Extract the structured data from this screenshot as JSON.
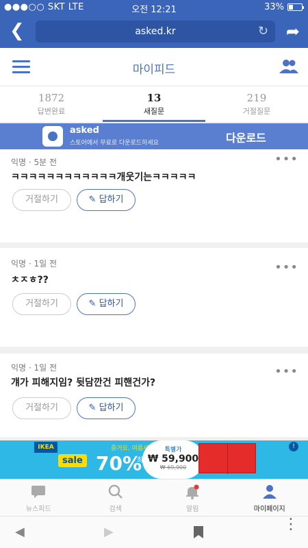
{
  "status_bar": {
    "carrier": "●●●○○ SKT  LTE",
    "time": "오전 12:21",
    "battery": "33%"
  },
  "browser": {
    "url": "asked.kr",
    "icons": [
      "back-icon",
      "reload-icon",
      "share-icon"
    ]
  },
  "header": {
    "title": "마이피드",
    "icons": [
      "menu-icon",
      "people-icon"
    ]
  },
  "stats": [
    {
      "count": "1872",
      "label": "답변완료"
    },
    {
      "count": "13",
      "label": "새질문"
    },
    {
      "count": "219",
      "label": "거절질문"
    }
  ],
  "banner": {
    "name": "asked",
    "desc": "스토어에서 무료로 다운로드하세요",
    "action": "다운로드"
  },
  "questions": [
    {
      "meta": "익명 · 5분 전",
      "text": "ㅋㅋㅋㅋㅋㅋㅋㅋㅋㅋㅋㅋ개웃기는ㅋㅋㅋㅋㅋ",
      "reject": "거절하기",
      "answer": "답하기"
    },
    {
      "meta": "익명 · 1일 전",
      "text": "ㅊㅈㅎ??",
      "reject": "거절하기",
      "answer": "답하기"
    },
    {
      "meta": "익명 · 1일 전",
      "text": "걔가 피해지임? 뒷담깐건 피핸건가?",
      "reject": "거절하기",
      "answer": "답하기"
    }
  ],
  "ad": {
    "brand": "IKEA",
    "promo": "즐거요, 여름세일",
    "sale": "sale",
    "percent": "70%",
    "max": "최대",
    "price_label": "특별가",
    "price": "₩ 59,900",
    "price_old": "₩ 69,900"
  },
  "bottom_nav": [
    {
      "label": "뉴스피드",
      "icon": "newsfeed-icon"
    },
    {
      "label": "검색",
      "icon": "search-icon"
    },
    {
      "label": "알림",
      "icon": "bell-icon"
    },
    {
      "label": "마이페이지",
      "icon": "profile-icon"
    }
  ],
  "more_glyph": "•••",
  "colors": {
    "primary": "#4b73c4",
    "browser": "#3a65b8",
    "banner": "#5b7fd0"
  }
}
